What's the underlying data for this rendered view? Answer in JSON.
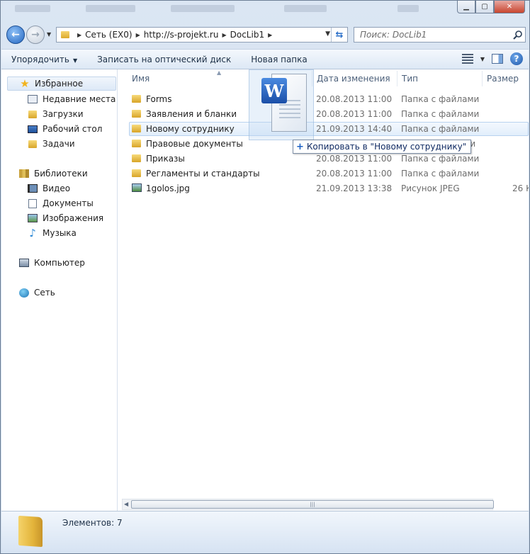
{
  "window": {
    "minimize": "▁",
    "maximize": "▢",
    "close": "✕"
  },
  "address": {
    "segments": [
      "Сеть (EX0)",
      "http://s-projekt.ru",
      "DocLib1"
    ]
  },
  "search": {
    "placeholder": "Поиск: DocLib1"
  },
  "toolbar": {
    "organize": "Упорядочить",
    "burn": "Записать на оптический диск",
    "new_folder": "Новая папка"
  },
  "sidebar": {
    "favorites": "Избранное",
    "fav_items": [
      "Недавние места",
      "Загрузки",
      "Рабочий стол",
      "Задачи"
    ],
    "libraries": "Библиотеки",
    "lib_items": [
      "Видео",
      "Документы",
      "Изображения",
      "Музыка"
    ],
    "computer": "Компьютер",
    "network": "Сеть"
  },
  "columns": {
    "name": "Имя",
    "date": "Дата изменения",
    "type": "Тип",
    "size": "Размер"
  },
  "files": [
    {
      "name": "Forms",
      "date": "20.08.2013 11:00",
      "type": "Папка с файлами",
      "size": "",
      "kind": "folder"
    },
    {
      "name": "Заявления и бланки",
      "date": "20.08.2013 11:00",
      "type": "Папка с файлами",
      "size": "",
      "kind": "folder"
    },
    {
      "name": "Новому сотруднику",
      "date": "21.09.2013 14:40",
      "type": "Папка с файлами",
      "size": "",
      "kind": "folder"
    },
    {
      "name": "Правовые документы",
      "date": "",
      "type": "",
      "size": "",
      "kind": "folder"
    },
    {
      "name": "Приказы",
      "date": "20.08.2013 11:00",
      "type": "Папка с файлами",
      "size": "",
      "kind": "folder"
    },
    {
      "name": "Регламенты и стандарты",
      "date": "20.08.2013 11:00",
      "type": "Папка с файлами",
      "size": "",
      "kind": "folder"
    },
    {
      "name": "1golos.jpg",
      "date": "21.09.2013 13:38",
      "type": "Рисунок JPEG",
      "size": "26 К",
      "kind": "jpg"
    }
  ],
  "drag": {
    "tooltip": "Копировать в \"Новому сотруднику\"",
    "doc_letter": "W"
  },
  "partial_row_type_tail": "ами",
  "status": {
    "count": "Элементов: 7"
  }
}
